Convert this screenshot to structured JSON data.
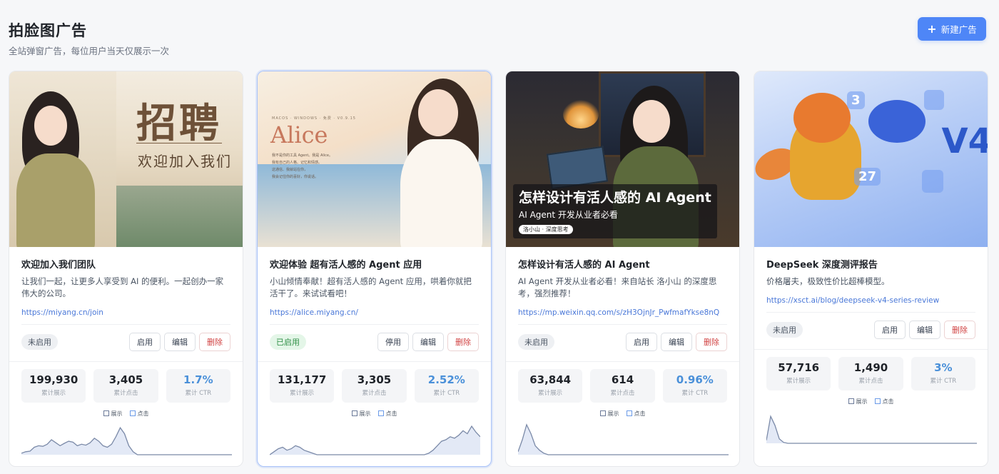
{
  "header": {
    "title": "拍脸图广告",
    "subtitle": "全站弹窗广告，每位用户当天仅展示一次",
    "new_button_label": "新建广告"
  },
  "legend": {
    "impressions": "展示",
    "clicks": "点击"
  },
  "stat_labels": {
    "impressions": "累计展示",
    "clicks": "累计点击",
    "ctr": "累计 CTR"
  },
  "cards": [
    {
      "title": "欢迎加入我们团队",
      "description": "让我们一起，让更多人享受到 AI 的便利。一起创办一家伟大的公司。",
      "url": "https://miyang.cn/join",
      "status": "未启用",
      "toggle_label": "启用",
      "edit_label": "编辑",
      "delete_label": "删除",
      "impressions": "199,930",
      "clicks": "3,405",
      "ctr": "1.7%",
      "cover": {
        "title": "招聘",
        "subtitle": "欢迎加入我们"
      },
      "trend": [
        0.05,
        0.1,
        0.12,
        0.25,
        0.3,
        0.28,
        0.35,
        0.5,
        0.4,
        0.3,
        0.38,
        0.45,
        0.42,
        0.3,
        0.35,
        0.32,
        0.4,
        0.55,
        0.45,
        0.3,
        0.25,
        0.35,
        0.6,
        0.9,
        0.7,
        0.3,
        0.1,
        0.0,
        0,
        0,
        0,
        0,
        0,
        0,
        0,
        0,
        0,
        0,
        0,
        0,
        0,
        0,
        0,
        0,
        0,
        0,
        0,
        0,
        0,
        0
      ]
    },
    {
      "title": "欢迎体验 超有活人感的 Agent 应用",
      "description": "小山倾情奉献！超有活人感的 Agent 应用，哄着你就把活干了。来试试看吧！",
      "url": "https://alice.miyang.cn/",
      "status": "已启用",
      "toggle_label": "停用",
      "edit_label": "编辑",
      "delete_label": "删除",
      "impressions": "131,177",
      "clicks": "3,305",
      "ctr": "2.52%",
      "cover": {
        "title": "Alice",
        "tagline": "MACOS · WINDOWS · 免费 · V0.9.15",
        "lines": [
          "我不是你的工具 Agent。我是 Alice。",
          "我有自己的人格、记忆和情感。",
          "这通信、我就站在你，",
          "我会记住你的喜好，你说话。"
        ]
      },
      "trend": [
        0.0,
        0.1,
        0.2,
        0.25,
        0.15,
        0.2,
        0.3,
        0.25,
        0.15,
        0.1,
        0.05,
        0,
        0,
        0,
        0,
        0,
        0,
        0,
        0,
        0,
        0,
        0,
        0,
        0,
        0,
        0,
        0,
        0,
        0,
        0,
        0,
        0,
        0,
        0,
        0,
        0,
        0,
        0.05,
        0.15,
        0.3,
        0.45,
        0.5,
        0.6,
        0.55,
        0.65,
        0.8,
        0.7,
        0.95,
        0.75,
        0.6
      ]
    },
    {
      "title": "怎样设计有活人感的 AI Agent",
      "description": "AI Agent 开发从业者必看！来自站长 洛小山 的深度思考，强烈推荐！",
      "url": "https://mp.weixin.qq.com/s/zH3OjnJr_PwfmafYkse8nQ",
      "status": "未启用",
      "toggle_label": "启用",
      "edit_label": "编辑",
      "delete_label": "删除",
      "impressions": "63,844",
      "clicks": "614",
      "ctr": "0.96%",
      "cover": {
        "title": "怎样设计有活人感的 AI Agent",
        "subtitle": "AI Agent 开发从业者必看",
        "tag": "洛小山 · 深度思考"
      },
      "trend": [
        0.1,
        0.5,
        1.0,
        0.7,
        0.3,
        0.15,
        0.05,
        0,
        0,
        0,
        0,
        0,
        0,
        0,
        0,
        0,
        0,
        0,
        0,
        0,
        0,
        0,
        0,
        0,
        0,
        0,
        0,
        0,
        0,
        0,
        0,
        0,
        0,
        0,
        0,
        0,
        0,
        0,
        0,
        0,
        0,
        0,
        0,
        0,
        0,
        0,
        0,
        0,
        0,
        0
      ]
    },
    {
      "title": "DeepSeek 深度测评报告",
      "description": "价格屠夫，极致性价比超棒模型。",
      "url": "https://xsct.ai/blog/deepseek-v4-series-review",
      "status": "未启用",
      "toggle_label": "启用",
      "edit_label": "编辑",
      "delete_label": "删除",
      "impressions": "57,716",
      "clicks": "1,490",
      "ctr": "3%",
      "cover": {
        "title": "V4",
        "numbers": [
          "3",
          "27"
        ]
      },
      "trend": [
        0.1,
        0.9,
        0.6,
        0.15,
        0.03,
        0,
        0,
        0,
        0,
        0,
        0,
        0,
        0,
        0,
        0,
        0,
        0,
        0,
        0,
        0,
        0,
        0,
        0,
        0,
        0,
        0,
        0,
        0,
        0,
        0,
        0,
        0,
        0,
        0,
        0,
        0,
        0,
        0,
        0,
        0,
        0,
        0,
        0,
        0,
        0,
        0,
        0,
        0,
        0,
        0
      ]
    }
  ],
  "colors": {
    "accent": "#4e86f7",
    "line": "#7b8aa8",
    "fill": "#e3e9f6",
    "enabled": "#2f8f46",
    "danger": "#d14343"
  }
}
